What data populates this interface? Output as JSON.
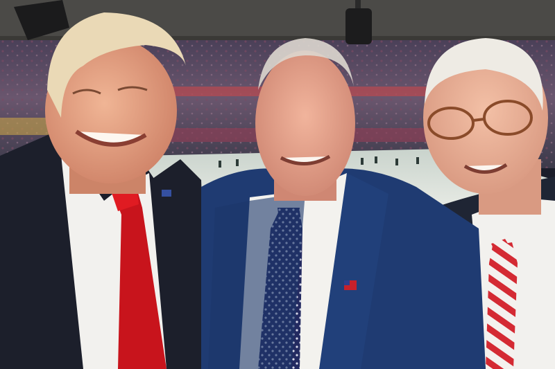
{
  "image": {
    "kind": "photograph",
    "people_count": 3,
    "colors": {
      "ceiling": "#4a4a48",
      "crowd_dark": "#3b3550",
      "crowd_mid": "#6f5a7a",
      "crowd_red": "#b3454c",
      "field": "#d7ddd6",
      "suit_left": "#1c1f2b",
      "suit_middle": "#1f3b72",
      "suit_right": "#1e2433",
      "shirt": "#f1f1ee",
      "tie_red": "#c8141c",
      "tie_navy": "#1e2456",
      "skin": "#e7a48b",
      "hair_blond": "#ead9b6",
      "hair_white": "#ece9e2"
    }
  }
}
